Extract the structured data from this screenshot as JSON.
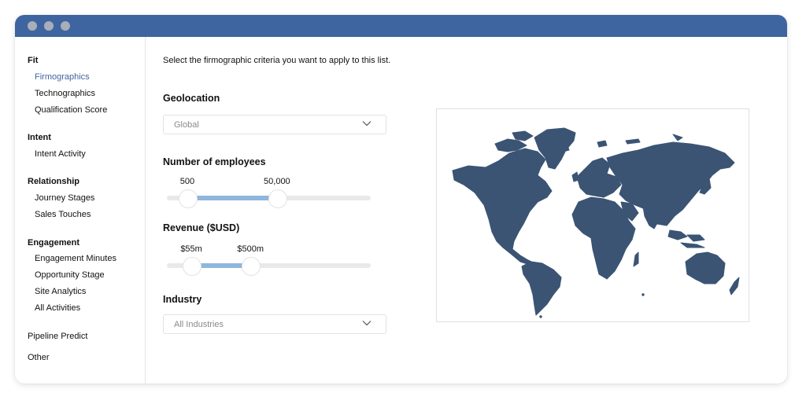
{
  "window": {
    "titlebar_color": "#3f65a0",
    "controls": [
      "window-dot",
      "window-dot",
      "window-dot"
    ]
  },
  "sidebar": {
    "groups": [
      {
        "heading": "Fit",
        "items": [
          {
            "label": "Firmographics",
            "active": true
          },
          {
            "label": "Technographics",
            "active": false
          },
          {
            "label": "Qualification Score",
            "active": false
          }
        ]
      },
      {
        "heading": "Intent",
        "items": [
          {
            "label": "Intent Activity",
            "active": false
          }
        ]
      },
      {
        "heading": "Relationship",
        "items": [
          {
            "label": "Journey Stages",
            "active": false
          },
          {
            "label": "Sales Touches",
            "active": false
          }
        ]
      },
      {
        "heading": "Engagement",
        "items": [
          {
            "label": "Engagement Minutes",
            "active": false
          },
          {
            "label": "Opportunity Stage",
            "active": false
          },
          {
            "label": "Site Analytics",
            "active": false
          },
          {
            "label": "All Activities",
            "active": false
          }
        ]
      }
    ],
    "plain_items": [
      "Pipeline Predict",
      "Other"
    ],
    "active_color": "#3f65a0"
  },
  "main": {
    "intro": "Select the firmographic criteria you want to apply to this list.",
    "geolocation": {
      "label": "Geolocation",
      "value": "Global"
    },
    "employees": {
      "label": "Number of employees",
      "min_label": "500",
      "max_label": "50,000",
      "min_fraction": 0.1,
      "max_fraction": 0.54
    },
    "revenue": {
      "label": "Revenue ($USD)",
      "min_label": "$55m",
      "max_label": "$500m",
      "min_fraction": 0.12,
      "max_fraction": 0.41
    },
    "industry": {
      "label": "Industry",
      "value": "All Industries"
    },
    "map": {
      "name": "world-map",
      "land_color": "#3b5474",
      "range_color": "#8fb6dd"
    }
  }
}
